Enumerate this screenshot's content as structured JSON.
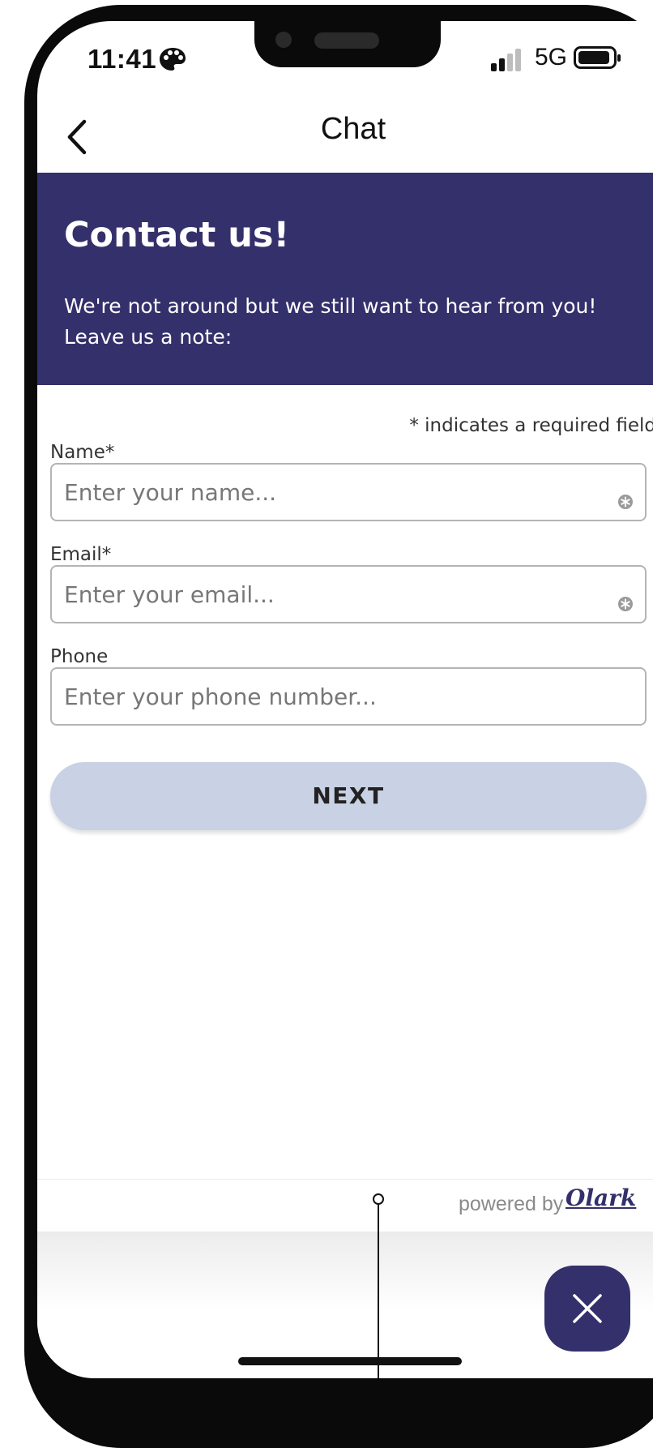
{
  "status_bar": {
    "time": "11:41",
    "network": "5G",
    "icons": [
      "palette-icon",
      "signal-icon",
      "battery-icon"
    ]
  },
  "nav": {
    "title": "Chat",
    "back_icon": "chevron-left-icon"
  },
  "header": {
    "title": "Contact us!",
    "subtitle_line1": "We're not around but we still want to hear from you!",
    "subtitle_line2": "Leave us a note:",
    "background_color": "#34306b"
  },
  "form": {
    "required_note": "* indicates a required field",
    "fields": [
      {
        "label": "Name*",
        "placeholder": "Enter your name...",
        "value": "",
        "required": true
      },
      {
        "label": "Email*",
        "placeholder": "Enter your email...",
        "value": "",
        "required": true
      },
      {
        "label": "Phone",
        "placeholder": "Enter your phone number...",
        "value": "",
        "required": false
      }
    ],
    "next_label": "NEXT",
    "next_color": "#c9d1e5"
  },
  "footer": {
    "powered_by": "powered by",
    "brand": "Olark",
    "close_icon": "close-icon",
    "accent_color": "#34306b"
  }
}
